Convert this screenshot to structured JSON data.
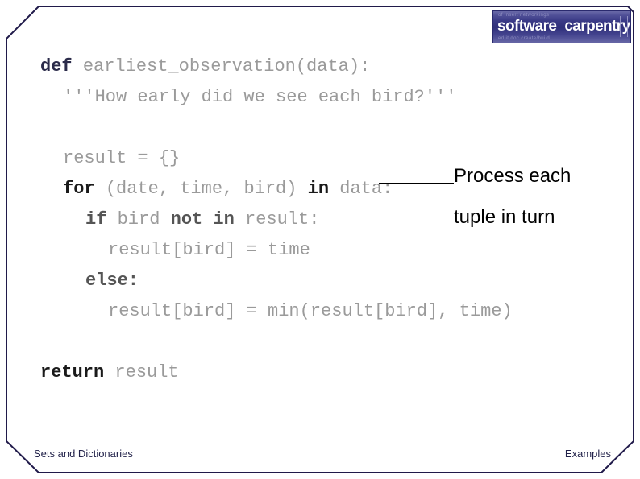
{
  "slide": {
    "frame_color": "#201a4a",
    "background": "#ffffff"
  },
  "logo": {
    "word1": "software",
    "word2": "carpentry",
    "faint_top": "of  insert  networkings",
    "faint_bot": "ed it doc  create/build",
    "bg_color": "#3a3a86",
    "text_color": "#ffffff"
  },
  "code": {
    "language": "python",
    "lines": [
      {
        "indent": 0,
        "tokens": [
          {
            "t": "def ",
            "style": "kw"
          },
          {
            "t": "earliest_observation(data):",
            "style": "plain"
          }
        ]
      },
      {
        "indent": 1,
        "tokens": [
          {
            "t": "'''How early did we see each bird?'''",
            "style": "plain"
          }
        ]
      },
      {
        "indent": 0,
        "tokens": [
          {
            "t": "",
            "style": "plain"
          }
        ]
      },
      {
        "indent": 1,
        "tokens": [
          {
            "t": "result = {}",
            "style": "plain"
          }
        ]
      },
      {
        "indent": 1,
        "tokens": [
          {
            "t": "for ",
            "style": "kw2"
          },
          {
            "t": "(date, time, bird) ",
            "style": "plain"
          },
          {
            "t": "in ",
            "style": "kw2"
          },
          {
            "t": "data:",
            "style": "plain"
          }
        ]
      },
      {
        "indent": 2,
        "tokens": [
          {
            "t": "if ",
            "style": "kw3"
          },
          {
            "t": "bird ",
            "style": "plain"
          },
          {
            "t": "not in ",
            "style": "kw3"
          },
          {
            "t": "result:",
            "style": "plain"
          }
        ]
      },
      {
        "indent": 3,
        "tokens": [
          {
            "t": "result[bird] = time",
            "style": "plain"
          }
        ]
      },
      {
        "indent": 2,
        "tokens": [
          {
            "t": "else:",
            "style": "kw3"
          }
        ]
      },
      {
        "indent": 3,
        "tokens": [
          {
            "t": "result[bird] = min(result[bird], time)",
            "style": "plain"
          }
        ]
      },
      {
        "indent": 0,
        "tokens": [
          {
            "t": "",
            "style": "plain"
          }
        ]
      },
      {
        "indent": 0,
        "tokens": [
          {
            "t": "return ",
            "style": "kw2"
          },
          {
            "t": "result",
            "style": "plain"
          }
        ]
      }
    ]
  },
  "annotation": {
    "line1": "Process each",
    "line2": "tuple in turn",
    "color": "#000000"
  },
  "footer": {
    "left": "Sets and Dictionaries",
    "right": "Examples"
  }
}
